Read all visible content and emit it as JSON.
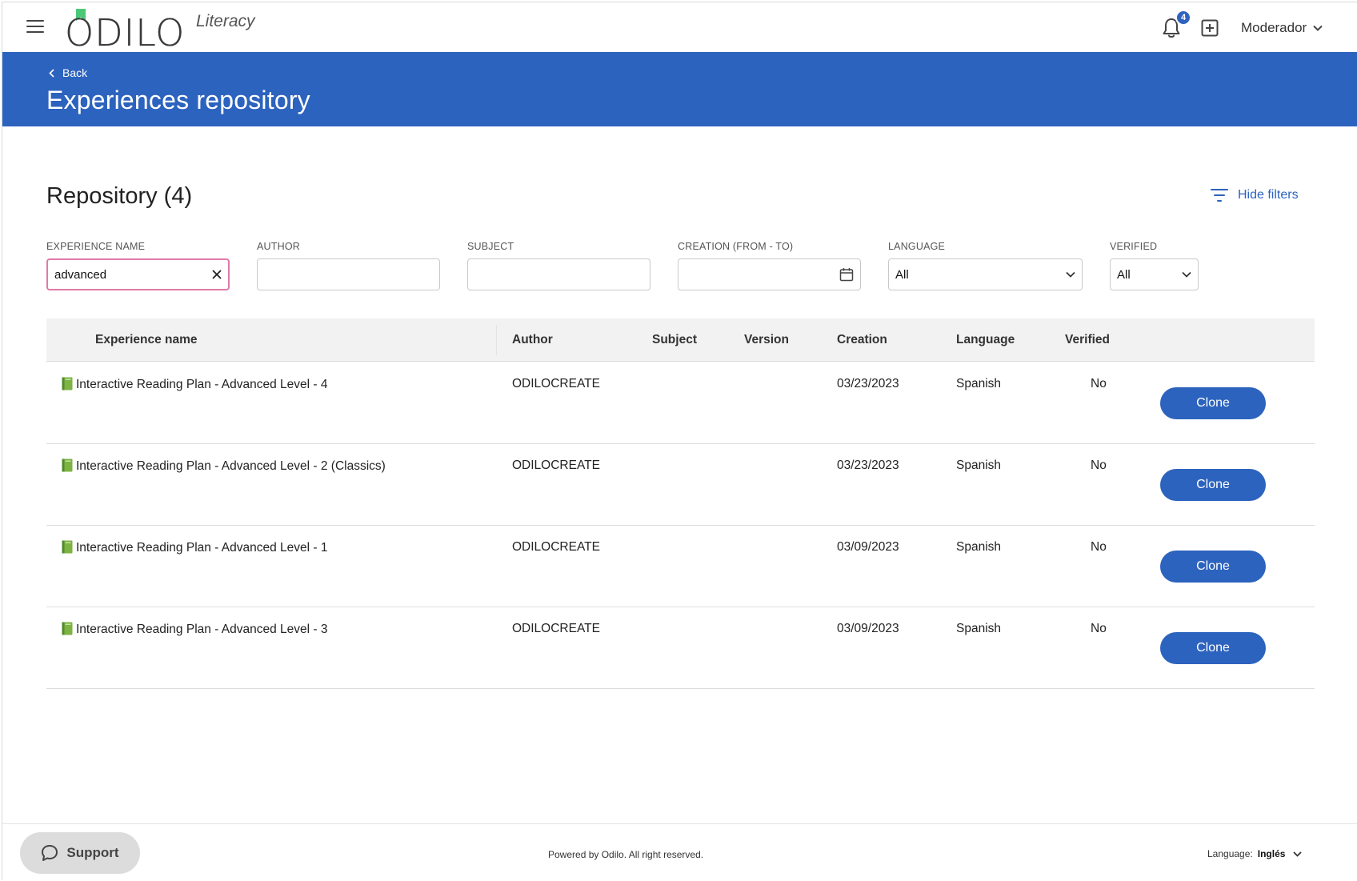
{
  "header": {
    "logo_main": "ODILO",
    "logo_sub": "Literacy",
    "notification_count": "4",
    "user_name": "Moderador"
  },
  "banner": {
    "back_label": "Back",
    "title": "Experiences repository"
  },
  "repository": {
    "title": "Repository (4)",
    "hide_filters_label": "Hide filters"
  },
  "filters": {
    "experience_name": {
      "label": "EXPERIENCE NAME",
      "value": "advanced"
    },
    "author": {
      "label": "AUTHOR",
      "value": ""
    },
    "subject": {
      "label": "SUBJECT",
      "value": ""
    },
    "creation": {
      "label": "CREATION (FROM - TO)",
      "value": ""
    },
    "language": {
      "label": "LANGUAGE",
      "value": "All"
    },
    "verified": {
      "label": "VERIFIED",
      "value": "All"
    }
  },
  "table": {
    "columns": {
      "name": "Experience name",
      "author": "Author",
      "subject": "Subject",
      "version": "Version",
      "creation": "Creation",
      "language": "Language",
      "verified": "Verified"
    },
    "rows": [
      {
        "name": "Interactive Reading Plan - Advanced Level - 4",
        "author": "ODILOCREATE",
        "subject": "",
        "version": "",
        "creation": "03/23/2023",
        "language": "Spanish",
        "verified": "No",
        "action": "Clone"
      },
      {
        "name": "Interactive Reading Plan - Advanced Level - 2 (Classics)",
        "author": "ODILOCREATE",
        "subject": "",
        "version": "",
        "creation": "03/23/2023",
        "language": "Spanish",
        "verified": "No",
        "action": "Clone"
      },
      {
        "name": "Interactive Reading Plan - Advanced Level - 1",
        "author": "ODILOCREATE",
        "subject": "",
        "version": "",
        "creation": "03/09/2023",
        "language": "Spanish",
        "verified": "No",
        "action": "Clone"
      },
      {
        "name": "Interactive Reading Plan - Advanced Level - 3",
        "author": "ODILOCREATE",
        "subject": "",
        "version": "",
        "creation": "03/09/2023",
        "language": "Spanish",
        "verified": "No",
        "action": "Clone"
      }
    ]
  },
  "footer": {
    "support_label": "Support",
    "powered_text": "Powered by Odilo. All right reserved.",
    "language_label": "Language:",
    "language_value": "Inglés"
  },
  "colors": {
    "primary": "#2c63be",
    "active_input_border": "#e07aa7",
    "logo_flag": "#4cc777"
  }
}
